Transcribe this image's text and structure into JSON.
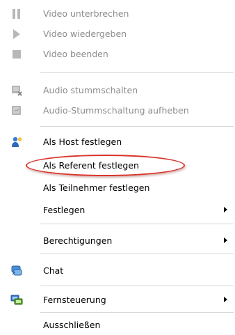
{
  "menu": {
    "items": [
      {
        "label": "Video unterbrechen",
        "icon": "pause-icon",
        "disabled": true
      },
      {
        "label": "Video wiedergeben",
        "icon": "play-icon",
        "disabled": true
      },
      {
        "label": "Video beenden",
        "icon": "stop-icon",
        "disabled": true
      },
      {
        "label": "Audio stummschalten",
        "icon": "mute-audio-icon",
        "disabled": true
      },
      {
        "label": "Audio-Stummschaltung aufheben",
        "icon": "unmute-audio-icon",
        "disabled": true
      },
      {
        "label": "Als Host festlegen",
        "icon": "host-icon",
        "disabled": false
      },
      {
        "label": "Als Referent festlegen",
        "disabled": false,
        "highlighted": true
      },
      {
        "label": "Als Teilnehmer festlegen",
        "disabled": false
      },
      {
        "label": "Festlegen",
        "disabled": false,
        "submenu": true
      },
      {
        "label": "Berechtigungen",
        "disabled": false,
        "submenu": true
      },
      {
        "label": "Chat",
        "icon": "chat-icon",
        "disabled": false
      },
      {
        "label": "Fernsteuerung",
        "icon": "remote-control-icon",
        "disabled": false,
        "submenu": true
      },
      {
        "label": "Ausschließen",
        "disabled": false
      }
    ]
  },
  "colors": {
    "disabled_text": "#8c8c8c",
    "highlight_ellipse": "#d9342a",
    "separator": "#d6d6d6"
  }
}
